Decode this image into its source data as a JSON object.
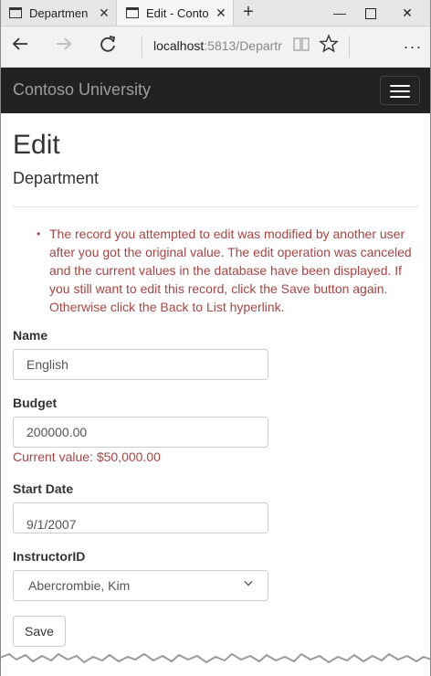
{
  "browser": {
    "tabs": [
      {
        "label": "Departmen"
      },
      {
        "label": "Edit - Conto"
      }
    ],
    "address": {
      "host": "localhost",
      "rest": ":5813/Departr"
    }
  },
  "site": {
    "brand": "Contoso University"
  },
  "page": {
    "title": "Edit",
    "subtitle": "Department",
    "validation_error": "The record you attempted to edit was modified by another user after you got the original value. The edit operation was canceled and the current values in the database have been displayed. If you still want to edit this record, click the Save button again. Otherwise click the Back to List hyperlink."
  },
  "form": {
    "name_label": "Name",
    "name_value": "English",
    "budget_label": "Budget",
    "budget_value": "200000.00",
    "budget_current": "Current value: $50,000.00",
    "startdate_label": "Start Date",
    "startdate_value": "9/1/2007",
    "instructor_label": "InstructorID",
    "instructor_value": "Abercrombie, Kim",
    "save_label": "Save"
  },
  "colors": {
    "error": "#a94442",
    "navbar": "#222222"
  }
}
